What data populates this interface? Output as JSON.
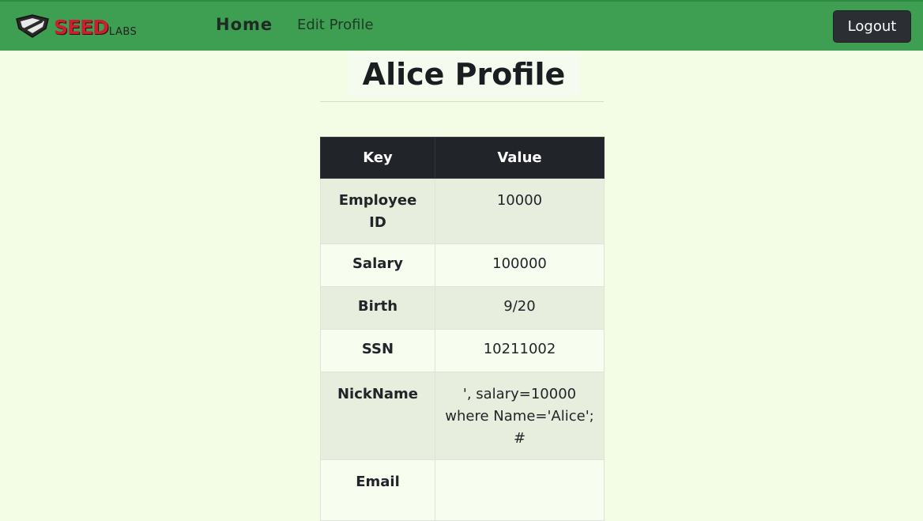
{
  "navbar": {
    "logo_text_main": "SEED",
    "logo_text_sub": "LABS",
    "home_label": "Home",
    "edit_profile_label": "Edit Profile",
    "logout_label": "Logout",
    "colors": {
      "bar": "#3e9f52",
      "logout_bg": "#2b2f33"
    }
  },
  "page": {
    "title": "Alice Profile"
  },
  "profile_table": {
    "headers": [
      "Key",
      "Value"
    ],
    "rows": [
      {
        "key": "Employee ID",
        "value": "10000"
      },
      {
        "key": "Salary",
        "value": "100000"
      },
      {
        "key": "Birth",
        "value": "9/20"
      },
      {
        "key": "SSN",
        "value": "10211002"
      },
      {
        "key": "NickName",
        "value": "', salary=10000 where Name='Alice'; #"
      },
      {
        "key": "Email",
        "value": ""
      }
    ]
  },
  "icons": {
    "logo": "seedlabs-shield-logo-icon"
  }
}
